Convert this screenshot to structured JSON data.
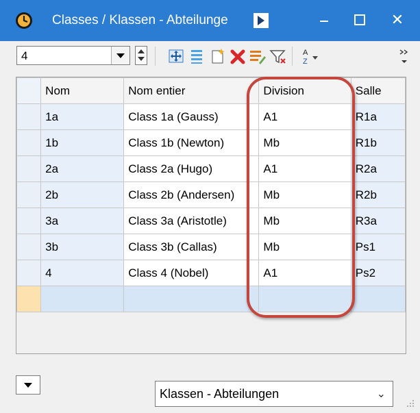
{
  "window": {
    "title": "Classes / Klassen - Abteilunge",
    "controls": {
      "minimize": "minimize",
      "maximize": "maximize",
      "close": "✕"
    }
  },
  "toolbar": {
    "filter_value": "4",
    "tools": [
      "move-icon",
      "list-icon",
      "new-icon",
      "delete-icon",
      "edit-icon",
      "filter-icon",
      "sort-icon",
      "overflow-icon"
    ]
  },
  "grid": {
    "columns": [
      "Nom",
      "Nom entier",
      "Division",
      "Salle"
    ],
    "rows": [
      {
        "nom": "1a",
        "entier": "Class 1a (Gauss)",
        "division": "A1",
        "salle": "R1a"
      },
      {
        "nom": "1b",
        "entier": "Class 1b (Newton)",
        "division": "Mb",
        "salle": "R1b"
      },
      {
        "nom": "2a",
        "entier": "Class 2a (Hugo)",
        "division": "A1",
        "salle": "R2a"
      },
      {
        "nom": "2b",
        "entier": "Class 2b (Andersen)",
        "division": "Mb",
        "salle": "R2b"
      },
      {
        "nom": "3a",
        "entier": "Class 3a (Aristotle)",
        "division": "Mb",
        "salle": "R3a"
      },
      {
        "nom": "3b",
        "entier": "Class 3b (Callas)",
        "division": "Mb",
        "salle": "Ps1"
      },
      {
        "nom": "4",
        "entier": "Class 4 (Nobel)",
        "division": "A1",
        "salle": "Ps2"
      }
    ]
  },
  "footer": {
    "view_select": "Klassen - Abteilungen"
  },
  "colors": {
    "titlebar": "#2b7cd3",
    "highlight": "#c3473f",
    "new_row_marker": "#fde2b0"
  }
}
